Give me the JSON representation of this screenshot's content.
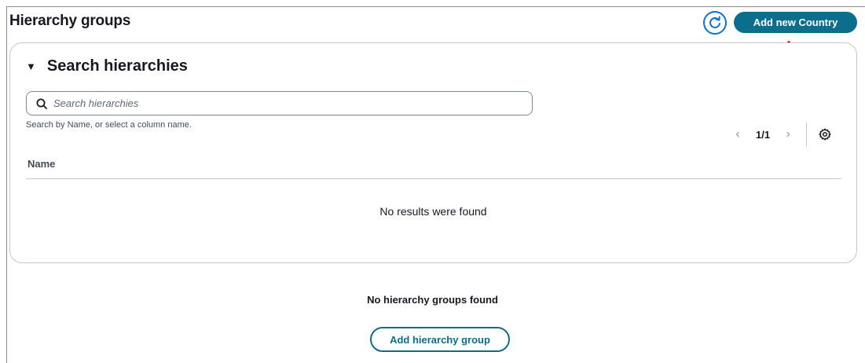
{
  "header": {
    "title": "Hierarchy groups",
    "refresh_icon": "refresh-icon",
    "add_button_label": "Add new Country"
  },
  "search_panel": {
    "caret_icon": "caret-down-icon",
    "caret_glyph": "▼",
    "title": "Search hierarchies",
    "search": {
      "placeholder": "Search hierarchies",
      "value": ""
    },
    "help_text": "Search by Name, or select a column name.",
    "pagination": {
      "prev_glyph": "‹",
      "page_label": "1/1",
      "next_glyph": "›"
    },
    "table": {
      "columns": [
        "Name"
      ],
      "empty_message": "No results were found"
    }
  },
  "empty_state": {
    "title": "No hierarchy groups found",
    "button_label": "Add hierarchy group"
  },
  "colors": {
    "primary": "#0b6e8c",
    "refresh_border": "#0972d3",
    "annotation_arrow": "#d40000"
  }
}
